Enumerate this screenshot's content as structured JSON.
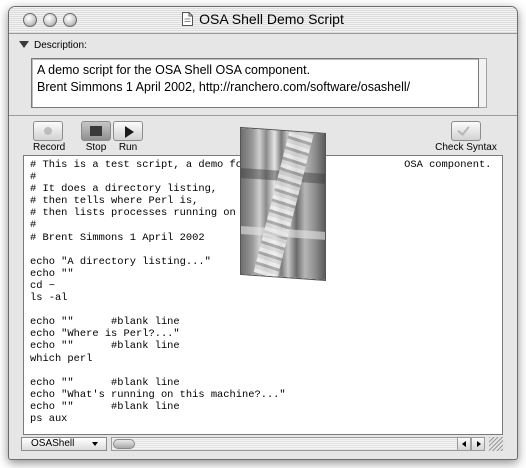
{
  "window": {
    "title": "OSA Shell Demo Script"
  },
  "description": {
    "header": "Description:",
    "text_line1": "A demo script for the OSA Shell OSA component.",
    "text_line2": "Brent Simmons 1 April 2002, http://ranchero.com/software/osashell/"
  },
  "toolbar": {
    "record_label": "Record",
    "stop_label": "Stop",
    "run_label": "Run",
    "check_syntax_label": "Check Syntax"
  },
  "editor": {
    "script": "# This is a test script, a demo for                         OSA component.\n#\n# It does a directory listing,\n# then tells where Perl is,\n# then lists processes running on this\n#\n# Brent Simmons 1 April 2002\n\necho \"A directory listing...\"\necho \"\"\ncd ~\nls -al\n\necho \"\"      #blank line\necho \"Where is Perl?...\"\necho \"\"      #blank line\nwhich perl\n\necho \"\"      #blank line\necho \"What's running on this machine?...\"\necho \"\"      #blank line\nps aux"
  },
  "bottom": {
    "language": "OSAShell"
  },
  "icons": {
    "disclosure": "triangle-down-icon",
    "record": "record-dot-icon",
    "stop": "stop-square-icon",
    "run": "play-triangle-icon",
    "check": "checkmark-icon",
    "doc": "script-document-icon"
  }
}
